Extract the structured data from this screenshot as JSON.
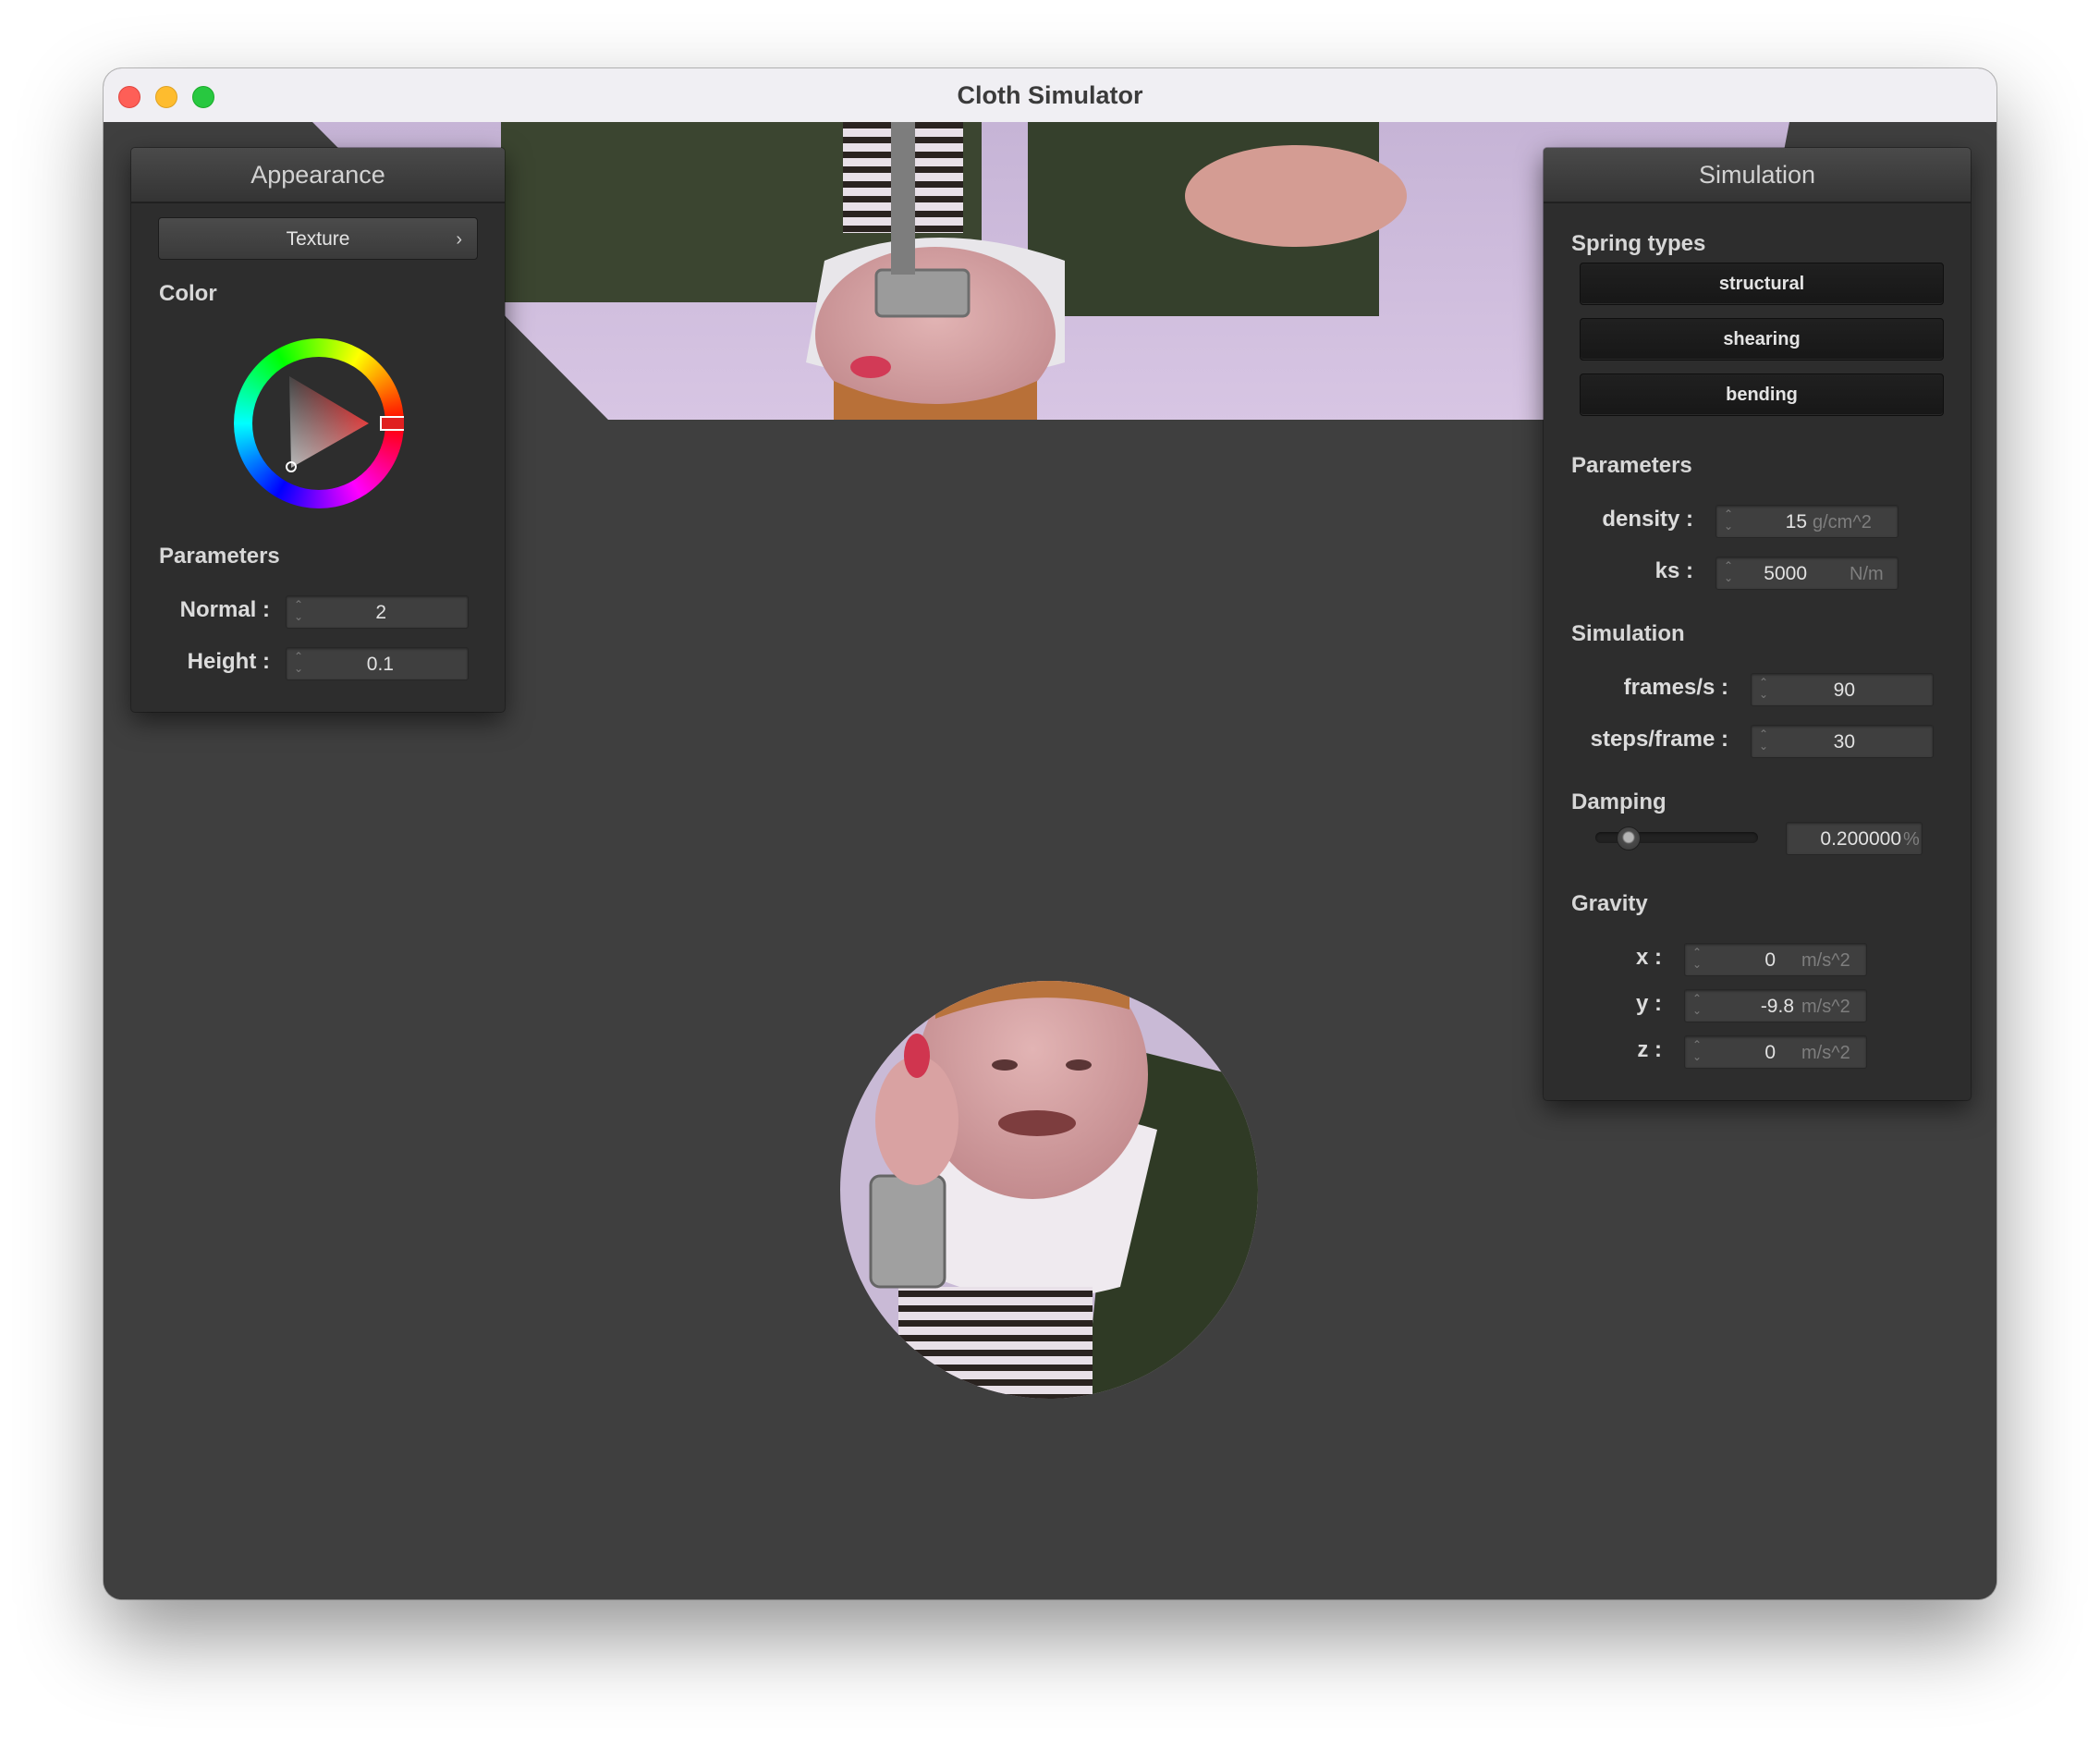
{
  "window": {
    "title": "Cloth Simulator"
  },
  "appearance": {
    "title": "Appearance",
    "texture_button": "Texture",
    "color_label": "Color",
    "color": "#e02020",
    "parameters_label": "Parameters",
    "normal": {
      "label": "Normal :",
      "value": "2"
    },
    "height": {
      "label": "Height :",
      "value": "0.1"
    }
  },
  "simulation": {
    "title": "Simulation",
    "spring_types_label": "Spring types",
    "spring_buttons": [
      "structural",
      "shearing",
      "bending"
    ],
    "parameters_label": "Parameters",
    "density": {
      "label": "density :",
      "value": "15",
      "unit": "g/cm^2"
    },
    "ks": {
      "label": "ks :",
      "value": "5000",
      "unit": "N/m"
    },
    "simulation_label": "Simulation",
    "frames": {
      "label": "frames/s :",
      "value": "90"
    },
    "steps": {
      "label": "steps/frame :",
      "value": "30"
    },
    "damping_label": "Damping",
    "damping": {
      "value": "0.200000",
      "unit": "%",
      "slider_fraction": 0.2
    },
    "gravity_label": "Gravity",
    "gravity": [
      {
        "label": "x :",
        "value": "0",
        "unit": "m/s^2"
      },
      {
        "label": "y :",
        "value": "-9.8",
        "unit": "m/s^2"
      },
      {
        "label": "z :",
        "value": "0",
        "unit": "m/s^2"
      }
    ]
  }
}
